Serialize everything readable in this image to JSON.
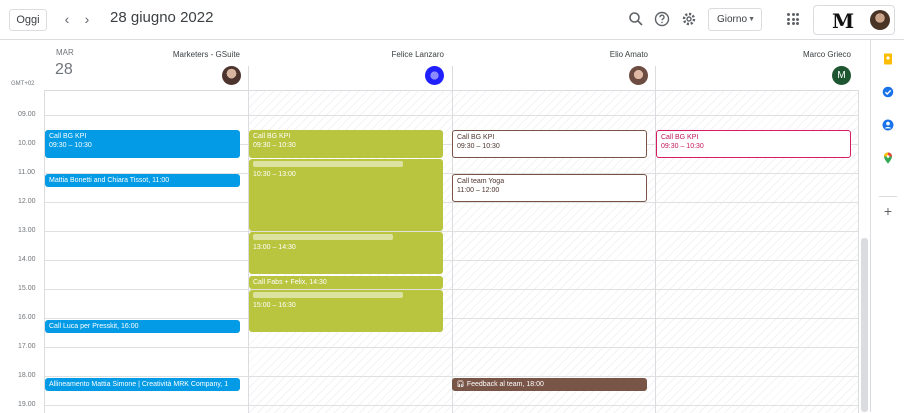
{
  "header": {
    "today_label": "Oggi",
    "prev_label": "‹",
    "next_label": "›",
    "date_title": "28 giugno 2022",
    "view_label": "Giorno",
    "brand": "M"
  },
  "day": {
    "abbr": "MAR",
    "num": "28"
  },
  "timezone": "GMT+02",
  "resources": [
    {
      "name": "Marketers - GSuite",
      "avatar_color": "#5d4037"
    },
    {
      "name": "Felice Lanzaro",
      "avatar_color": "#1a1aff"
    },
    {
      "name": "Elio Amato",
      "avatar_color": "#8d5b4c"
    },
    {
      "name": "Marco Grieco",
      "avatar_letter": "M",
      "avatar_color": "#1e5631"
    }
  ],
  "hours": [
    "09.00",
    "10.00",
    "11.00",
    "12.00",
    "13.00",
    "14.00",
    "15.00",
    "16.00",
    "17.00",
    "18.00",
    "19.00"
  ],
  "events": {
    "c1_bg": {
      "title": "Call BG KPI",
      "time": "09:30 – 10:30"
    },
    "c1_mattia": {
      "title": "Mattia Bonetti and Chiara Tissot, 11:00"
    },
    "c1_luca": {
      "title": "Call Luca per Presskit, 16:00"
    },
    "c1_allineamento": {
      "title": "Allineamento Mattia Simone | Creatività MRK Company, 1"
    },
    "c2_bg": {
      "title": "Call BG KPI",
      "time": "09:30 – 10:30"
    },
    "c2_blur1": {
      "time": "10:30 – 13:00"
    },
    "c2_blur2": {
      "time": "13:00 – 14:30"
    },
    "c2_fabs": {
      "title": "Call Fabs + Felix, 14:30"
    },
    "c2_blur3": {
      "time": "15:00 – 16:30"
    },
    "c3_bg": {
      "title": "Call BG KPI",
      "time": "09:30 – 10:30"
    },
    "c3_yoga": {
      "title": "Call team Yoga",
      "time": "11:00 – 12:00"
    },
    "c3_feedback": {
      "title": "Feedback al team, 18:00"
    },
    "c4_bg": {
      "title": "Call BG KPI",
      "time": "09:30 – 10:30"
    }
  },
  "icons": [
    "search-icon",
    "help-icon",
    "settings-icon",
    "apps-icon",
    "keep-icon",
    "tasks-icon",
    "contacts-icon",
    "maps-icon",
    "add-icon",
    "headphones-icon"
  ],
  "colors": {
    "blue": "#039be5",
    "green": "#b9c43f",
    "brown": "#795548",
    "red": "#d81b60"
  }
}
